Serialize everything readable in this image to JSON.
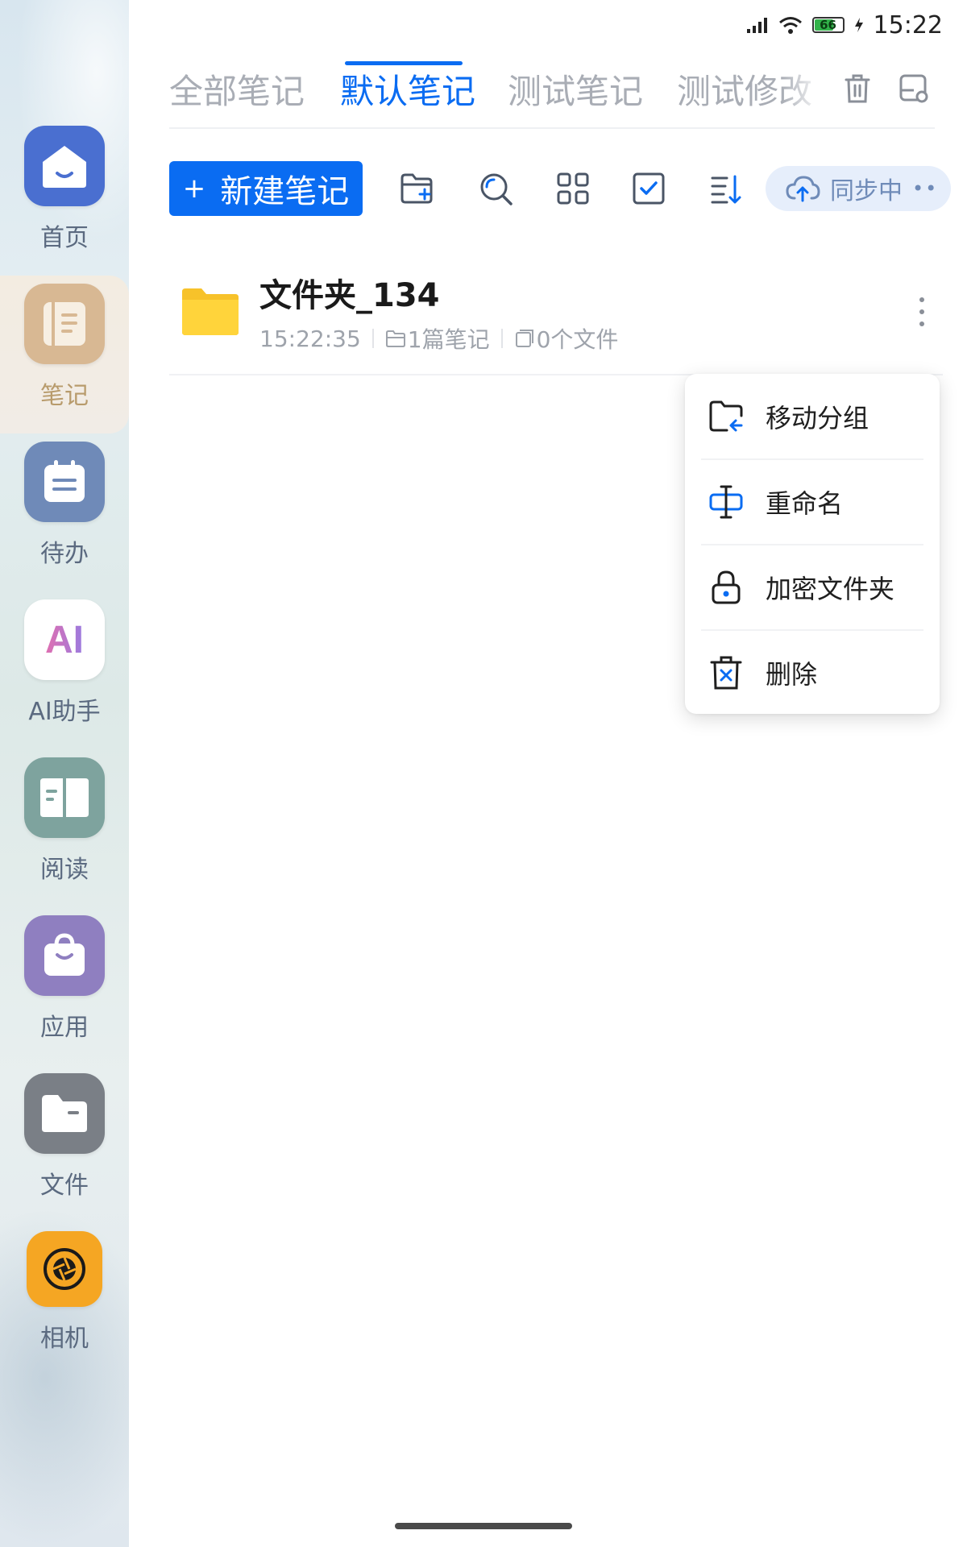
{
  "status_bar": {
    "battery_level": "66",
    "time": "15:22"
  },
  "sidebar": {
    "items": [
      {
        "label": "首页",
        "color": "#4a6fd0"
      },
      {
        "label": "笔记",
        "color": "#d8b893"
      },
      {
        "label": "待办",
        "color": "#6f8ab8"
      },
      {
        "label": "AI助手",
        "color": "#ffffff",
        "icon_text": "AI"
      },
      {
        "label": "阅读",
        "color": "#7ea39e"
      },
      {
        "label": "应用",
        "color": "#8f7fc0"
      },
      {
        "label": "文件",
        "color": "#7a7f86"
      },
      {
        "label": "相机",
        "color": "#f5a623"
      }
    ],
    "active_index": 1
  },
  "tabs": [
    {
      "label": "全部笔记",
      "active": false
    },
    {
      "label": "默认笔记",
      "active": true
    },
    {
      "label": "测试笔记",
      "active": false
    },
    {
      "label": "测试修改",
      "active": false
    }
  ],
  "toolbar": {
    "new_note_label": "新建笔记",
    "sync_label": "同步中"
  },
  "folder": {
    "name": "文件夹_134",
    "time": "15:22:35",
    "notes_count": "1篇笔记",
    "files_count": "0个文件"
  },
  "context_menu": {
    "items": [
      {
        "label": "移动分组",
        "icon": "folder-move-icon"
      },
      {
        "label": "重命名",
        "icon": "rename-cursor-icon"
      },
      {
        "label": "加密文件夹",
        "icon": "lock-icon"
      },
      {
        "label": "删除",
        "icon": "trash-delete-icon"
      }
    ]
  },
  "colors": {
    "accent": "#0a6cf2",
    "folder_yellow": "#ffcc33"
  }
}
